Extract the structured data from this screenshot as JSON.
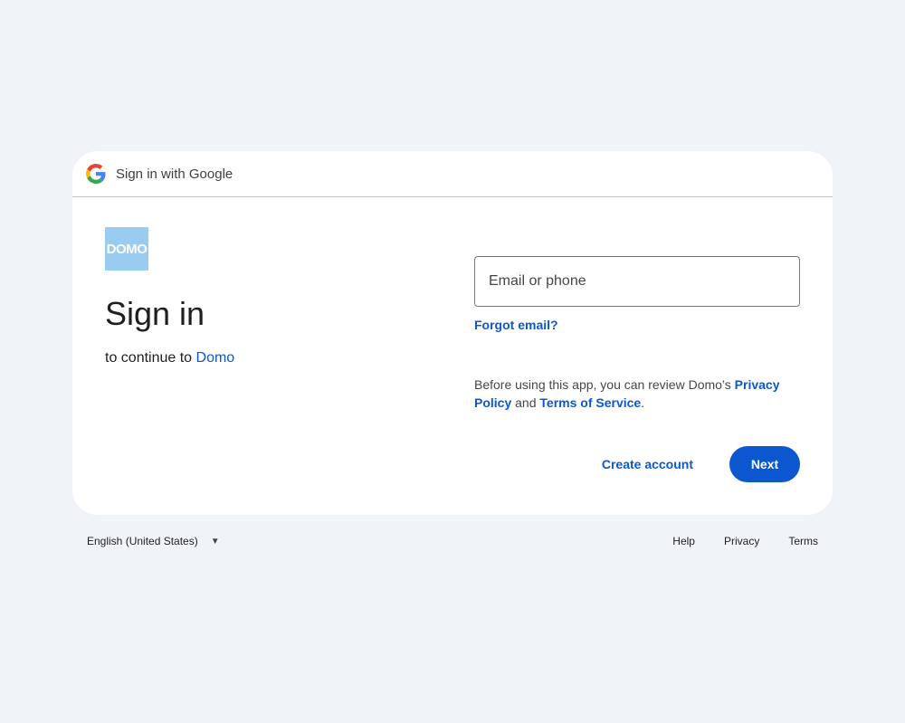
{
  "header": {
    "title": "Sign in with Google",
    "icon": "google-g-icon"
  },
  "app": {
    "logo_text": "DOMO",
    "logo_color": "#99ccee",
    "name": "Domo"
  },
  "main": {
    "title": "Sign in",
    "subtitle_prefix": "to continue to "
  },
  "form": {
    "email_placeholder": "Email or phone",
    "forgot_email": "Forgot email?",
    "notice_prefix": "Before using this app, you can review Domo’s ",
    "privacy_policy": "Privacy Policy",
    "notice_and": " and ",
    "terms_of_service": "Terms of Service",
    "notice_suffix": "."
  },
  "actions": {
    "create_account": "Create account",
    "next": "Next",
    "accent_color": "#0b57d0"
  },
  "footer": {
    "language": "English (United States)",
    "links": [
      "Help",
      "Privacy",
      "Terms"
    ]
  }
}
